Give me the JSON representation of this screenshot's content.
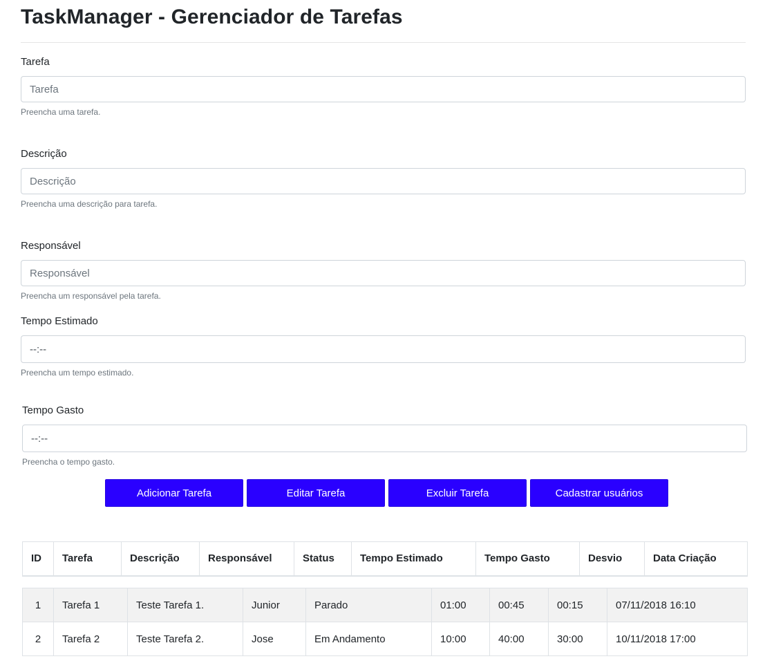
{
  "page": {
    "title": "TaskManager - Gerenciador de Tarefas"
  },
  "form": {
    "tarefa": {
      "label": "Tarefa",
      "placeholder": "Tarefa",
      "value": "",
      "help": "Preencha uma tarefa."
    },
    "descricao": {
      "label": "Descrição",
      "placeholder": "Descrição",
      "value": "",
      "help": "Preencha uma descrição para tarefa."
    },
    "responsavel": {
      "label": "Responsável",
      "placeholder": "Responsável",
      "value": "",
      "help": "Preencha um responsável pela tarefa."
    },
    "tempo_estimado": {
      "label": "Tempo Estimado",
      "placeholder": "--:--",
      "value": "",
      "help": "Preencha um tempo estimado."
    },
    "tempo_gasto": {
      "label": "Tempo Gasto",
      "placeholder": "--:--",
      "value": "",
      "help": "Preencha o tempo gasto."
    }
  },
  "buttons": {
    "add": "Adicionar Tarefa",
    "edit": "Editar Tarefa",
    "delete": "Excluir Tarefa",
    "register_users": "Cadastrar usuários"
  },
  "table": {
    "headers": [
      "ID",
      "Tarefa",
      "Descrição",
      "Responsável",
      "Status",
      "Tempo Estimado",
      "Tempo Gasto",
      "Desvio",
      "Data Criação"
    ],
    "rows": [
      [
        "1",
        "Tarefa 1",
        "Teste Tarefa 1.",
        "Junior",
        "Parado",
        "01:00",
        "00:45",
        "00:15",
        "07/11/2018 16:10"
      ],
      [
        "2",
        "Tarefa 2",
        "Teste Tarefa 2.",
        "Jose",
        "Em Andamento",
        "10:00",
        "40:00",
        "30:00",
        "10/11/2018 17:00"
      ]
    ]
  },
  "colors": {
    "primary_button": "#2a00ff",
    "stripe_row": "#f2f2f2",
    "border": "#dee2e6"
  }
}
